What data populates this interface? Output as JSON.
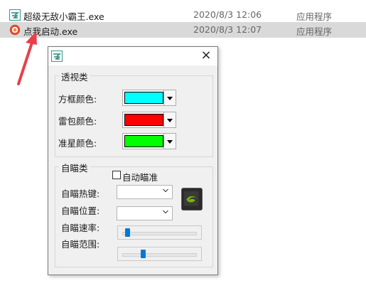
{
  "files": [
    {
      "name": "超级无敌小霸王.exe",
      "date": "2020/8/3 12:06",
      "type": "应用程序",
      "icon": "app-icon",
      "selected": false
    },
    {
      "name": "点我启动.exe",
      "date": "2020/8/3 12:07",
      "type": "应用程序",
      "icon": "red-circle-app-icon",
      "selected": true
    }
  ],
  "dialog": {
    "close_symbol": "×",
    "perspective": {
      "title": "透视类",
      "box_color_label": "方框颜色:",
      "box_color": "#00ffff",
      "mine_color_label": "雷包颜色:",
      "mine_color": "#ff0000",
      "crosshair_color_label": "准星颜色:",
      "crosshair_color": "#00ff00"
    },
    "aimbot": {
      "title": "自瞄类",
      "auto_aim_label": "自动瞄准",
      "auto_aim_checked": false,
      "hotkey_label": "自瞄热键:",
      "hotkey_value": "",
      "position_label": "自瞄位置:",
      "position_value": "",
      "speed_label": "自瞄速率:",
      "speed_level": 0.04,
      "range_label": "自瞄范围:",
      "range_level": 0.27
    }
  },
  "colors": {
    "arrow": "#e8404a",
    "selected_row": "#d9d9d9",
    "slider_thumb": "#0078d7"
  }
}
